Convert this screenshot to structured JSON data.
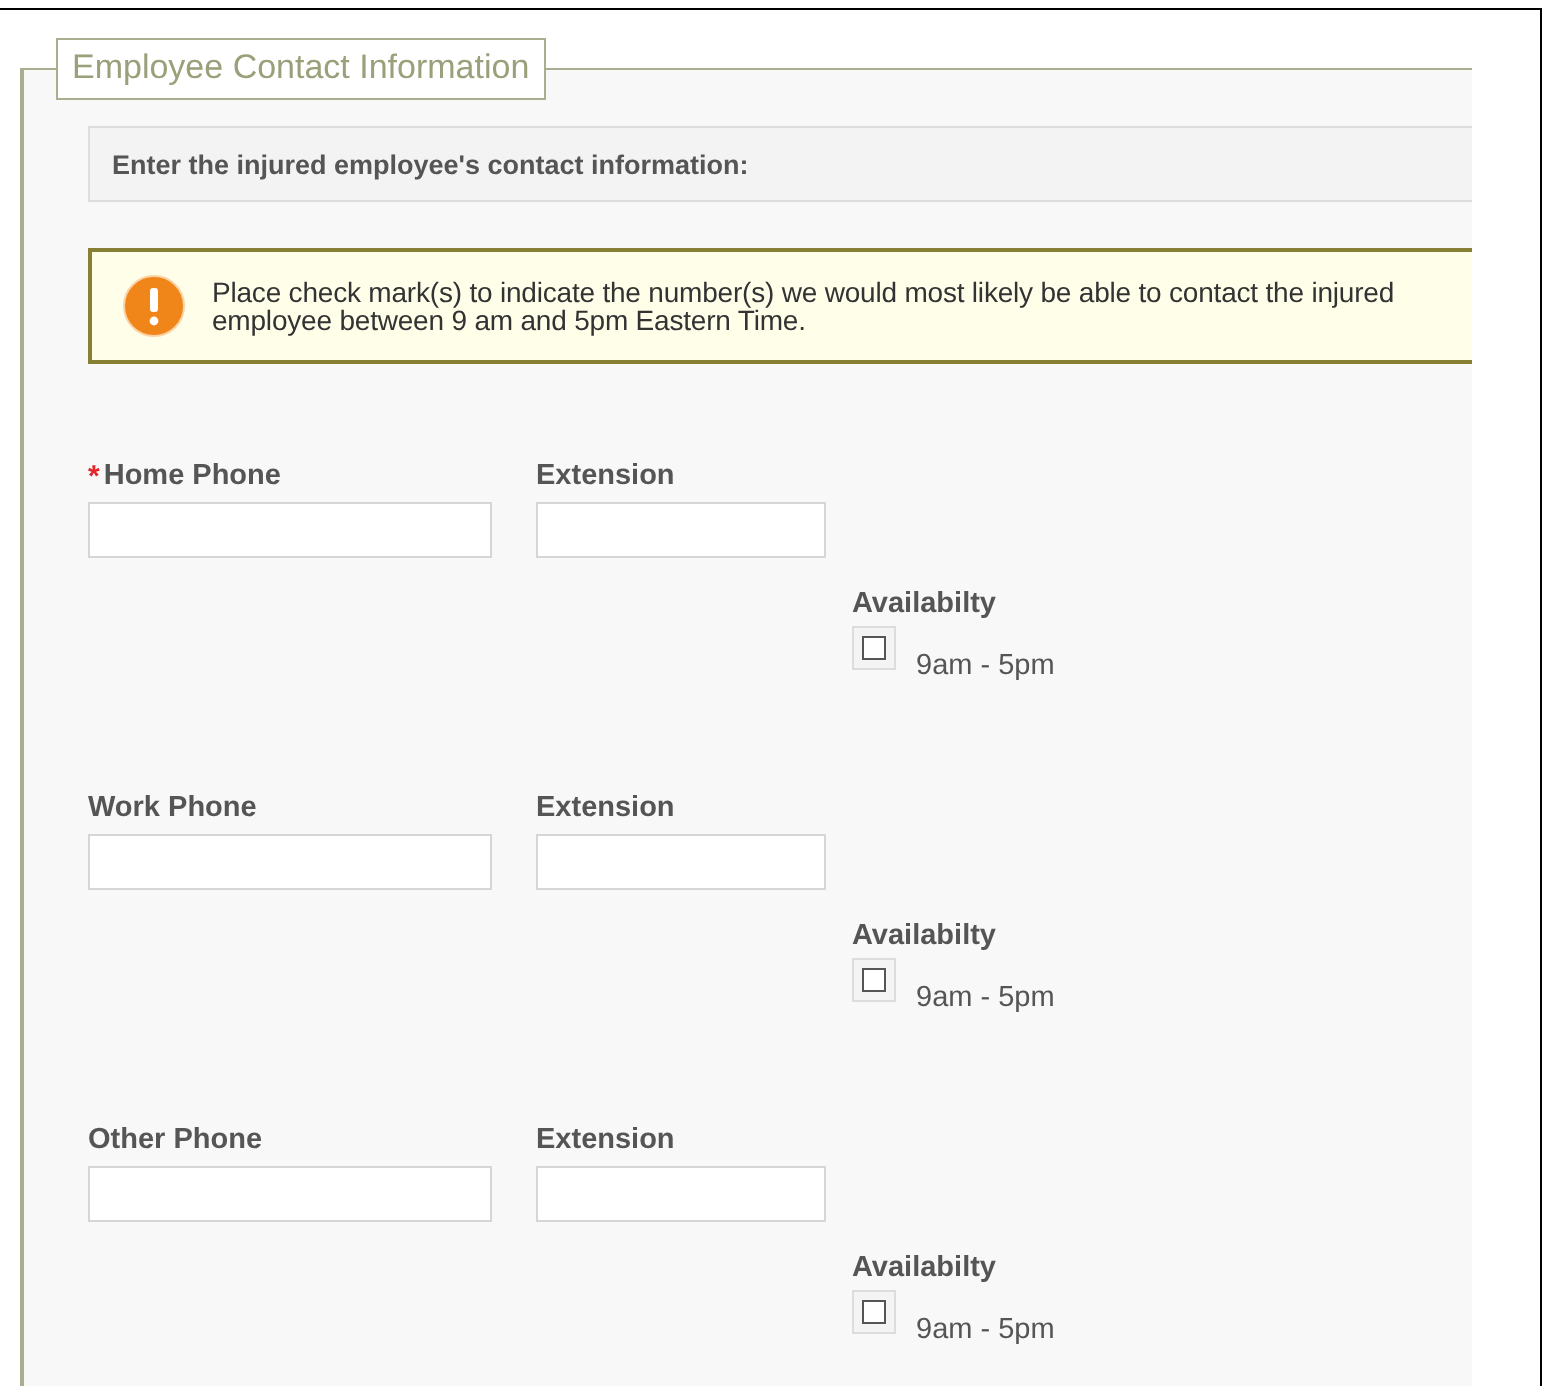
{
  "section": {
    "legend": "Employee Contact Information"
  },
  "instruction": "Enter the injured employee's contact information:",
  "notice": {
    "kind": "warning",
    "text": "Place check mark(s) to indicate the number(s) we would most likely be able to contact the injured employee between 9 am and 5pm Eastern Time."
  },
  "phones": [
    {
      "required_mark": "*",
      "label": "Home Phone",
      "extension_label": "Extension",
      "availability_label": "Availabilty",
      "option": "9am - 5pm",
      "checked": false
    },
    {
      "label": "Work Phone",
      "extension_label": "Extension",
      "availability_label": "Availabilty",
      "option": "9am - 5pm",
      "checked": false
    },
    {
      "label": "Other Phone",
      "extension_label": "Extension",
      "availability_label": "Availabilty",
      "option": "9am - 5pm",
      "checked": false
    }
  ]
}
